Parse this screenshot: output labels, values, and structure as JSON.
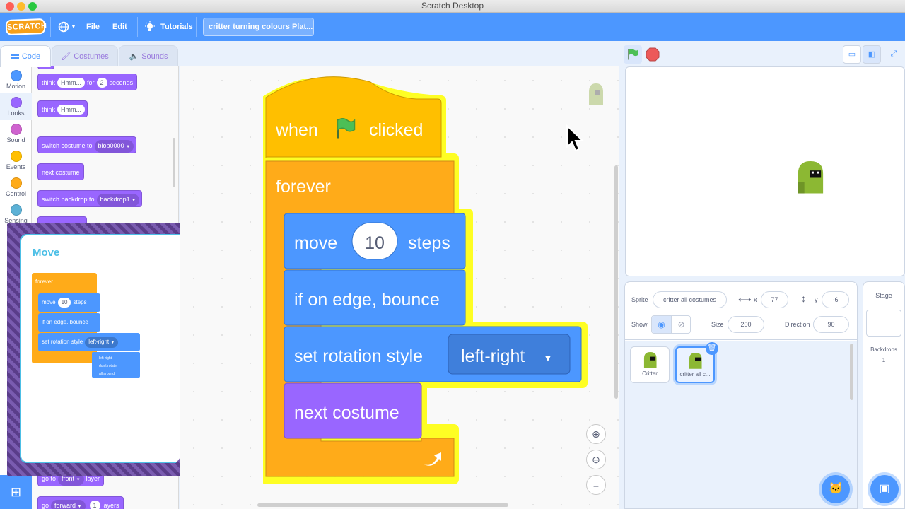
{
  "window": {
    "title": "Scratch Desktop"
  },
  "menu": {
    "logo": "SCRATCH",
    "file": "File",
    "edit": "Edit",
    "tutorials": "Tutorials",
    "project_title": "critter turning colours Plat..."
  },
  "tabs": [
    {
      "label": "Code"
    },
    {
      "label": "Costumes"
    },
    {
      "label": "Sounds"
    }
  ],
  "categories": [
    {
      "label": "Motion",
      "color": "#4c97ff"
    },
    {
      "label": "Looks",
      "color": "#9966ff"
    },
    {
      "label": "Sound",
      "color": "#cf63cf"
    },
    {
      "label": "Events",
      "color": "#ffbf00"
    },
    {
      "label": "Control",
      "color": "#ffab19"
    },
    {
      "label": "Sensing",
      "color": "#5cb1d6"
    }
  ],
  "palette": {
    "think_for": {
      "t1": "think",
      "arg": "Hmm...",
      "t2": "for",
      "num": "2",
      "t3": "seconds"
    },
    "think": {
      "t1": "think",
      "arg": "Hmm..."
    },
    "switch_costume": {
      "t1": "switch costume to",
      "arg": "blob0000"
    },
    "next_costume": "next costume",
    "switch_backdrop": {
      "t1": "switch backdrop to",
      "arg": "backdrop1"
    },
    "go_to_layer": {
      "t1": "go to",
      "arg": "front",
      "t2": "layer"
    },
    "go_layers": {
      "t1": "go",
      "arg": "forward",
      "num": "1",
      "t2": "layers"
    }
  },
  "card": {
    "title": "Move",
    "forever": "forever",
    "move": "move",
    "move_num": "10",
    "steps": "steps",
    "bounce": "if on edge, bounce",
    "rotation": "set rotation style",
    "rotation_val": "left-right",
    "options": [
      "left-right",
      "don't rotate",
      "all around"
    ]
  },
  "script": {
    "when": "when",
    "clicked": "clicked",
    "forever": "forever",
    "move": "move",
    "move_num": "10",
    "steps": "steps",
    "bounce": "if on edge, bounce",
    "rotation": "set rotation style",
    "rotation_val": "left-right",
    "next_costume": "next costume"
  },
  "sprite_info": {
    "sprite_label": "Sprite",
    "sprite_name": "critter all costumes",
    "x_label": "x",
    "x": "77",
    "y_label": "y",
    "y": "-6",
    "show_label": "Show",
    "size_label": "Size",
    "size": "200",
    "direction_label": "Direction",
    "direction": "90"
  },
  "sprites": [
    {
      "name": "Critter"
    },
    {
      "name": "critter all c..."
    }
  ],
  "stage_pane": {
    "title": "Stage",
    "backdrops_label": "Backdrops",
    "backdrops_count": "1"
  }
}
